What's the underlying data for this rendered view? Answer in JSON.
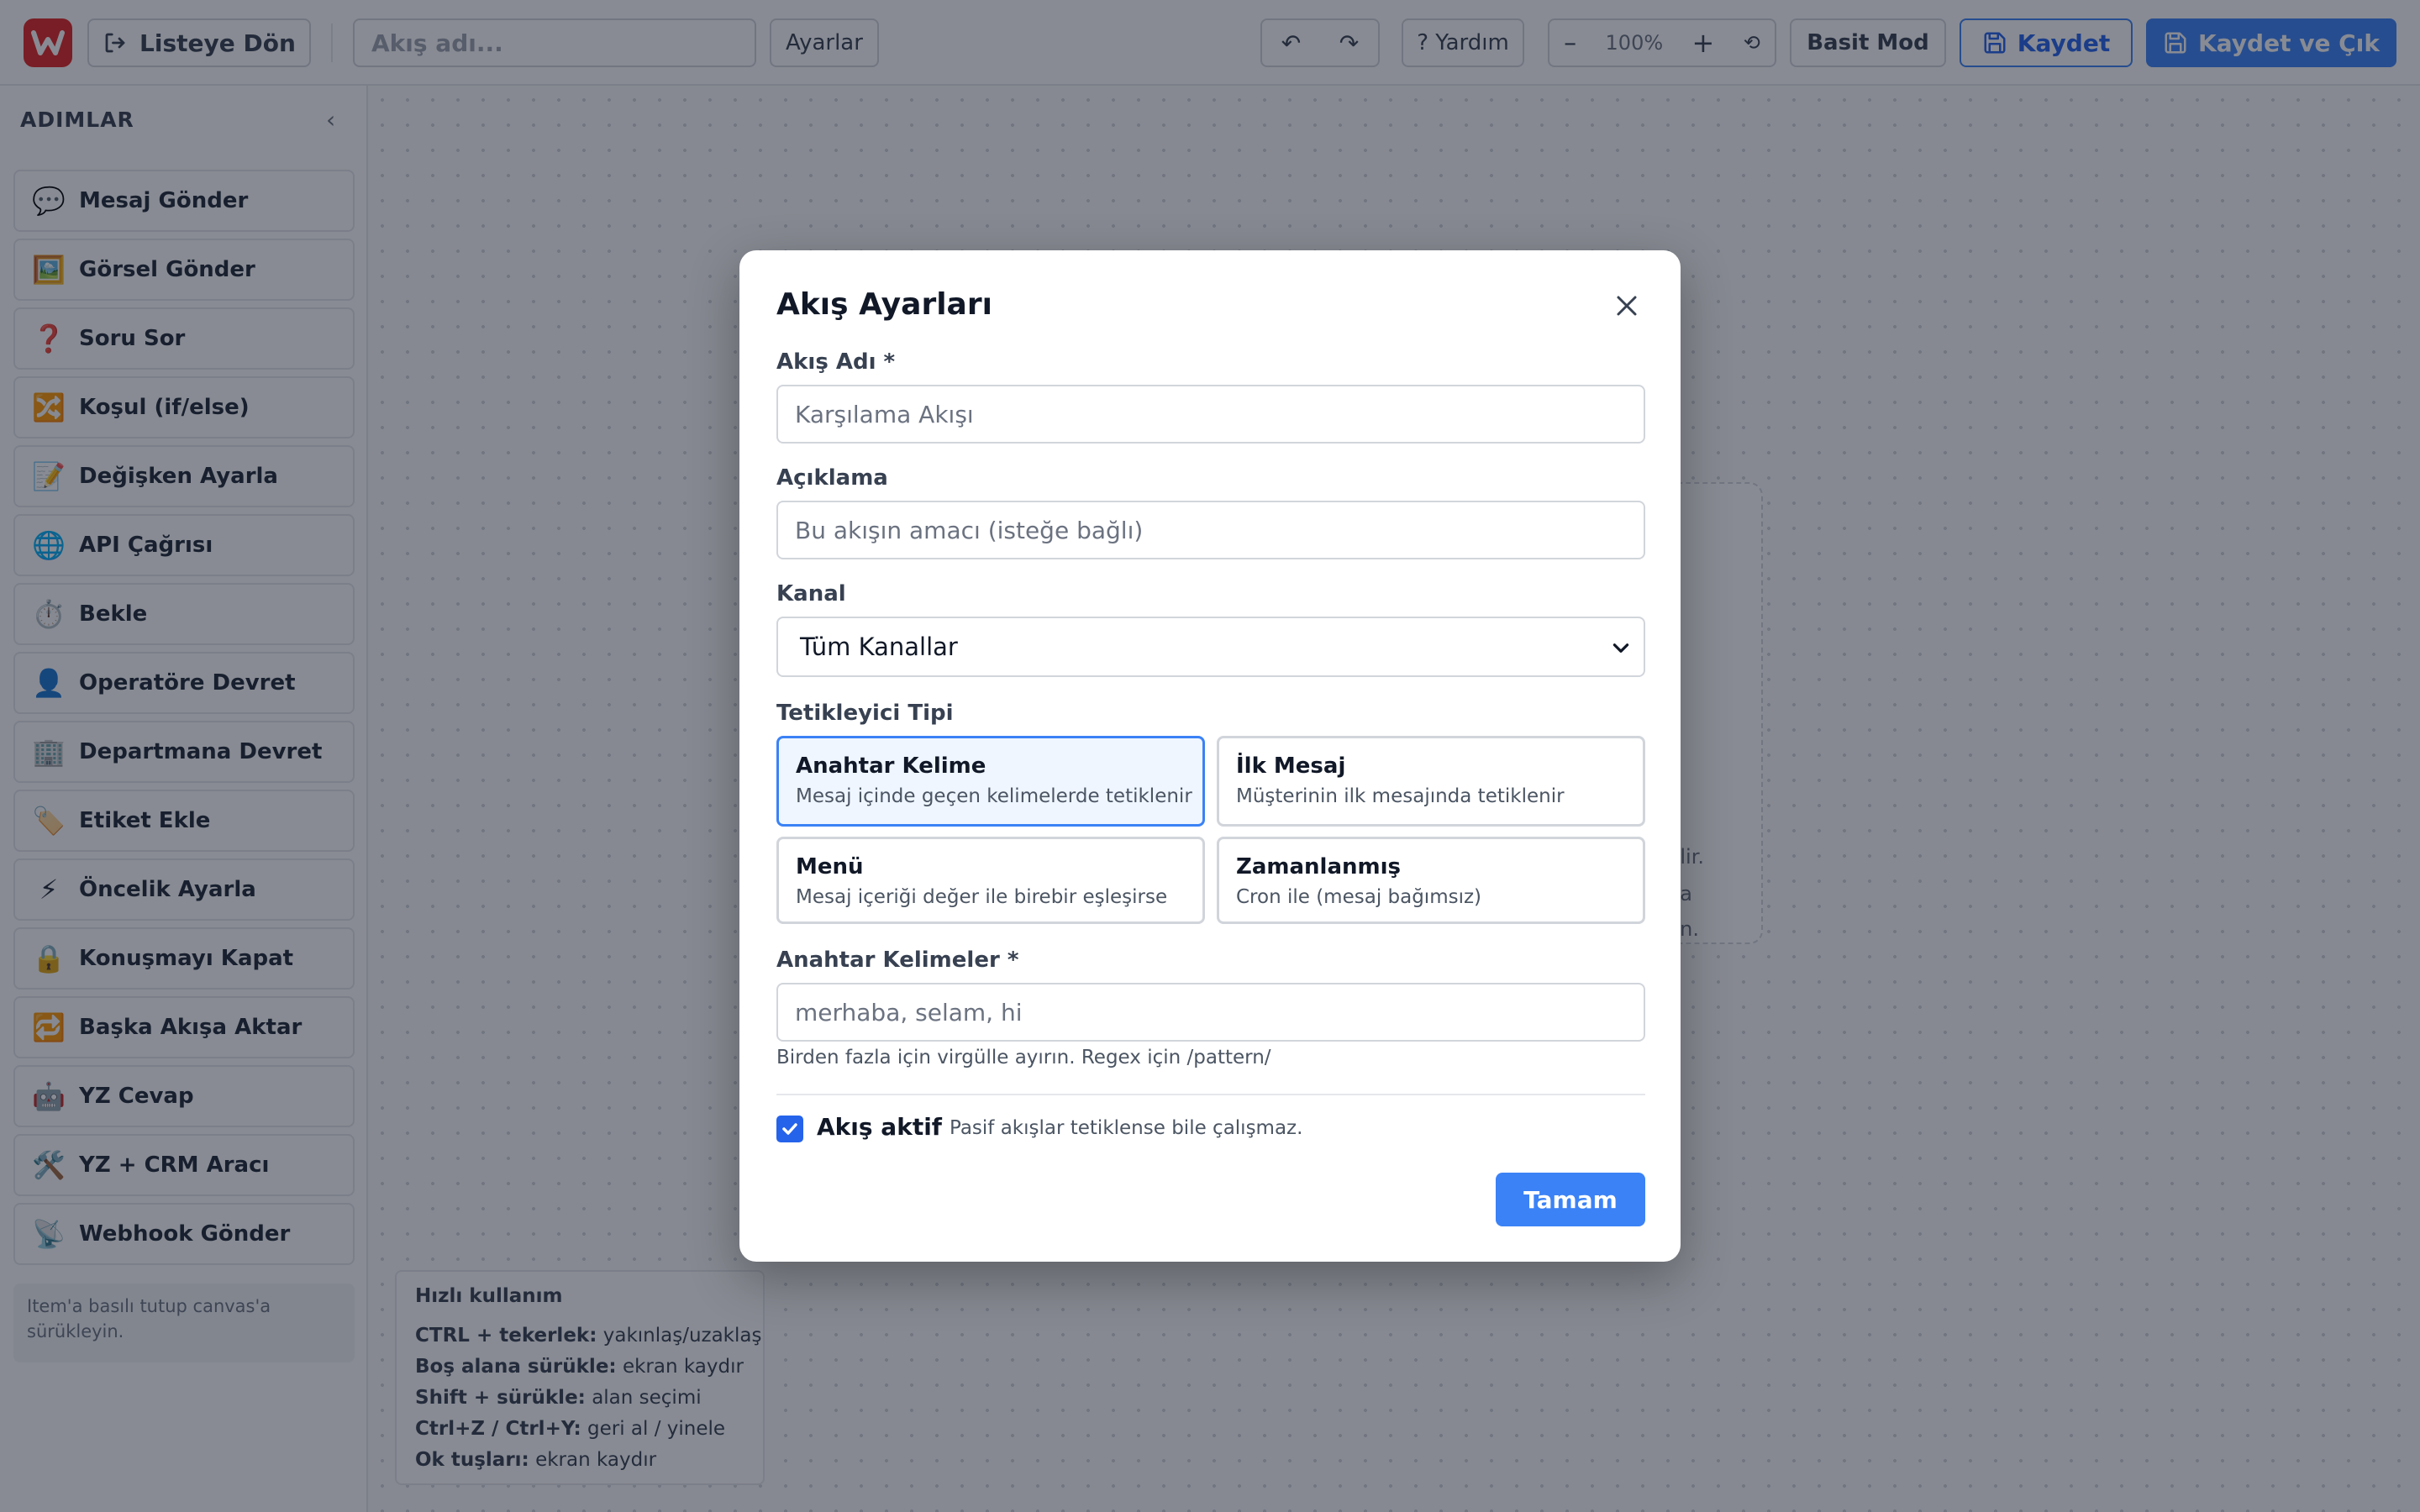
{
  "topbar": {
    "back_label": "Listeye Dön",
    "name_placeholder": "Akış adı...",
    "settings_label": "Ayarlar",
    "undo_symbol": "↶",
    "redo_symbol": "↷",
    "help_label": "? Yardım",
    "zoom_minus": "–",
    "zoom_level": "100%",
    "zoom_plus": "+",
    "zoom_reset": "⟲",
    "simple_mode_label": "Basit Mod",
    "save_label": "Kaydet",
    "save_exit_label": "Kaydet ve Çık",
    "accent_color": "#3b82f6",
    "logo_color": "#e02424"
  },
  "sidebar": {
    "title": "ADIMLAR",
    "collapse_symbol": "‹",
    "items": [
      {
        "icon": "💬",
        "label": "Mesaj Gönder"
      },
      {
        "icon": "🖼️",
        "label": "Görsel Gönder"
      },
      {
        "icon": "❓",
        "label": "Soru Sor"
      },
      {
        "icon": "🔀",
        "label": "Koşul (if/else)"
      },
      {
        "icon": "📝",
        "label": "Değişken Ayarla"
      },
      {
        "icon": "🌐",
        "label": "API Çağrısı"
      },
      {
        "icon": "⏱️",
        "label": "Bekle"
      },
      {
        "icon": "👤",
        "label": "Operatöre Devret"
      },
      {
        "icon": "🏢",
        "label": "Departmana Devret"
      },
      {
        "icon": "🏷️",
        "label": "Etiket Ekle"
      },
      {
        "icon": "⚡",
        "label": "Öncelik Ayarla"
      },
      {
        "icon": "🔒",
        "label": "Konuşmayı Kapat"
      },
      {
        "icon": "🔁",
        "label": "Başka Akışa Aktar"
      },
      {
        "icon": "🤖",
        "label": "YZ Cevap"
      },
      {
        "icon": "🛠️",
        "label": "YZ + CRM Aracı"
      },
      {
        "icon": "📡",
        "label": "Webhook Gönder"
      }
    ],
    "hint": "Item'a basılı tutup canvas'a sürükleyin."
  },
  "canvas": {
    "card_fragments": [
      "lir.",
      "a",
      "n."
    ],
    "quick_usage": {
      "title": "Hızlı kullanım",
      "shortcuts": [
        {
          "key": "CTRL + tekerlek:",
          "desc": "yakınlaş/uzaklaş"
        },
        {
          "key": "Boş alana sürükle:",
          "desc": "ekran kaydır"
        },
        {
          "key": "Shift + sürükle:",
          "desc": "alan seçimi"
        },
        {
          "key": "Ctrl+Z / Ctrl+Y:",
          "desc": "geri al / yinele"
        },
        {
          "key": "Ok tuşları:",
          "desc": "ekran kaydır"
        }
      ]
    }
  },
  "modal": {
    "title": "Akış Ayarları",
    "flow_name_label": "Akış Adı *",
    "flow_name_placeholder": "Karşılama Akışı",
    "description_label": "Açıklama",
    "description_placeholder": "Bu akışın amacı (isteğe bağlı)",
    "channel_label": "Kanal",
    "channel_value": "Tüm Kanallar",
    "trigger_label": "Tetikleyici Tipi",
    "triggers": [
      {
        "title": "Anahtar Kelime",
        "desc": "Mesaj içinde geçen kelimelerde tetiklenir",
        "selected": true
      },
      {
        "title": "İlk Mesaj",
        "desc": "Müşterinin ilk mesajında tetiklenir",
        "selected": false
      },
      {
        "title": "Menü",
        "desc": "Mesaj içeriği değer ile birebir eşleşirse",
        "selected": false
      },
      {
        "title": "Zamanlanmış",
        "desc": "Cron ile (mesaj bağımsız)",
        "selected": false
      }
    ],
    "keywords_label": "Anahtar Kelimeler *",
    "keywords_placeholder": "merhaba, selam, hi",
    "keywords_help": "Birden fazla için virgülle ayırın. Regex için /pattern/",
    "active_label": "Akış aktif",
    "active_checked": true,
    "active_hint": "Pasif akışlar tetiklense bile çalışmaz.",
    "ok_label": "Tamam"
  }
}
